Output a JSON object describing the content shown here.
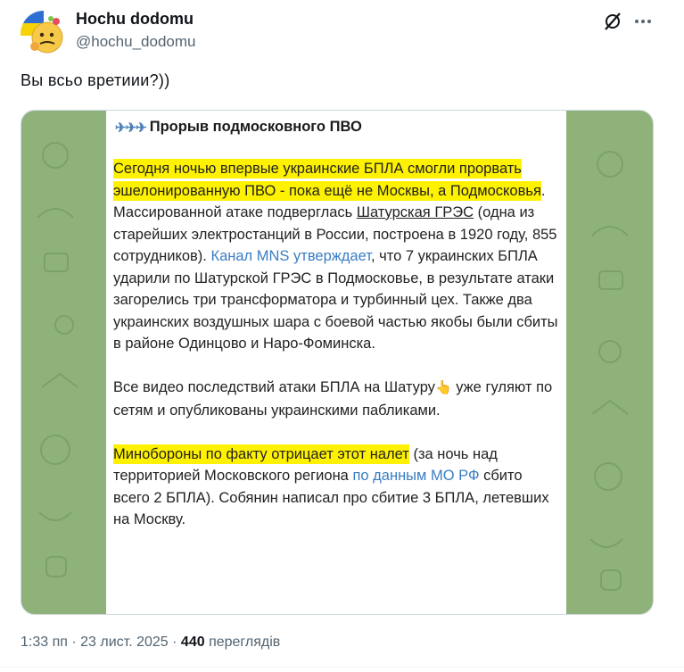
{
  "author": {
    "name": "Hochu dodomu",
    "handle": "@hochu_dodomu"
  },
  "tweet": {
    "text": "Вы  всьо  вретиии?))"
  },
  "image": {
    "title_icon": "airplanes-icon",
    "title": "Прорыв подмосковного ПВО",
    "p1_hl": "Сегодня ночью впервые украинские БПЛА смогли прорвать эшелонированную ПВО - пока ещё не Москвы, а Подмосковья",
    "p1_a": ". Массированной атаке подверглась ",
    "p1_link1": "Шатурская ГРЭС",
    "p1_b": " (одна из старейших электростанций в России, построена в 1920 году, 855 сотрудников). ",
    "p1_link2": "Канал MNS утверждает",
    "p1_c": ", что 7 украинских БПЛА ударили по Шатурской ГРЭС в Подмосковье, в результате атаки загорелись три трансформатора и турбинный цех. Также два украинских воздушных шара с боевой частью якобы были сбиты в районе Одинцово и Наро-Фоминска.",
    "p2_a": "Все видео последствий атаки БПЛА на Шатуру",
    "p2_b": " уже гуляют по сетям и опубликованы украинскими пабликами.",
    "p3_hl": "Минобороны по факту отрицает этот налет",
    "p3_a": " (за ночь над территорией Московского региона ",
    "p3_link": "по данным МО РФ",
    "p3_b": " сбито всего 2 БПЛА). Собянин написал про сбитие 3 БПЛА, летевших на Москву."
  },
  "meta": {
    "time": "1:33 пп",
    "sep": " · ",
    "date": "23 лист. 2025",
    "views": "440",
    "views_label": " переглядів"
  },
  "colors": {
    "highlight": "#fff200",
    "link": "#3a7cc4",
    "chat_bg": "#8fb27a"
  }
}
